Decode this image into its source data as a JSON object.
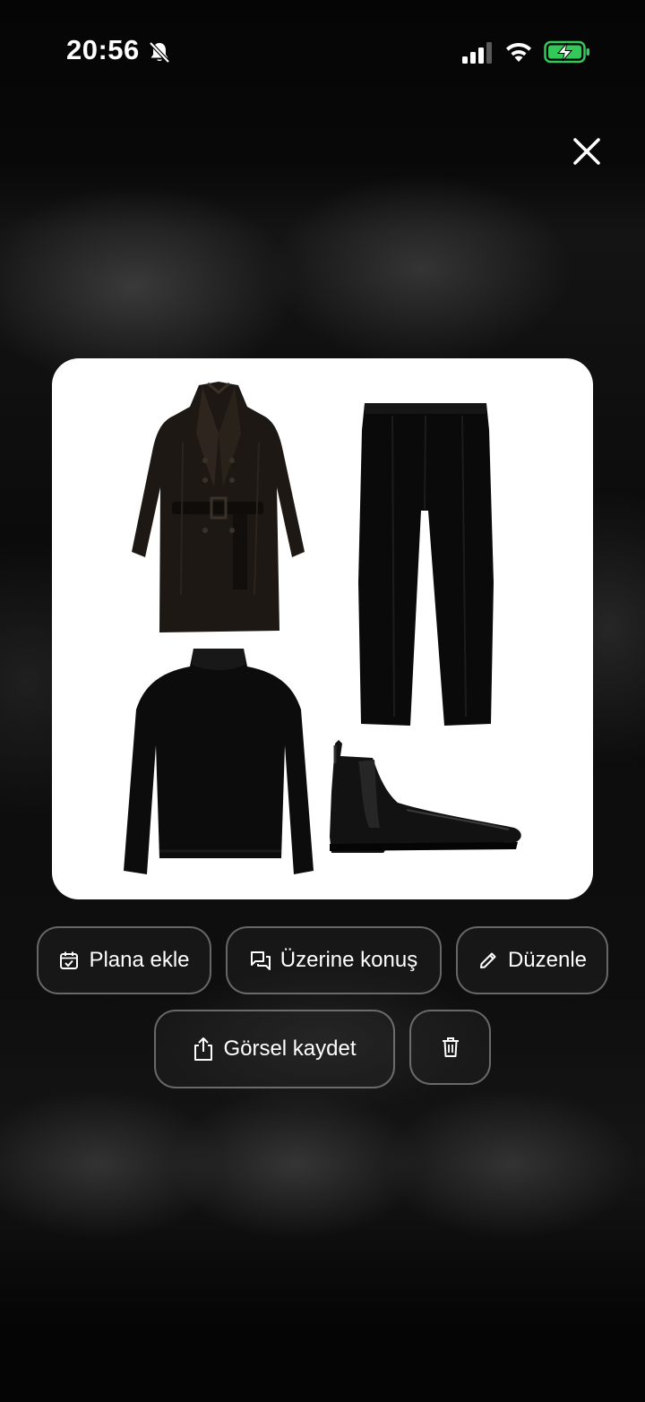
{
  "status_bar": {
    "time": "20:56",
    "icons": [
      "bell-slash-icon",
      "signal-icon",
      "wifi-icon",
      "battery-charging-icon"
    ],
    "battery_color": "#34c759"
  },
  "overlay": {
    "close_icon": "close-icon",
    "outfit_items": [
      {
        "name": "black-leather-trench-coat"
      },
      {
        "name": "black-trousers"
      },
      {
        "name": "black-turtleneck-sweater"
      },
      {
        "name": "black-chelsea-boot"
      }
    ]
  },
  "actions": {
    "plan_label": "Plana ekle",
    "plan_icon": "calendar-check-icon",
    "talk_label": "Üzerine konuş",
    "talk_icon": "chat-bubbles-icon",
    "edit_label": "Düzenle",
    "edit_icon": "pencil-icon",
    "save_label": "Görsel kaydet",
    "save_icon": "share-icon",
    "delete_icon": "trash-icon"
  }
}
